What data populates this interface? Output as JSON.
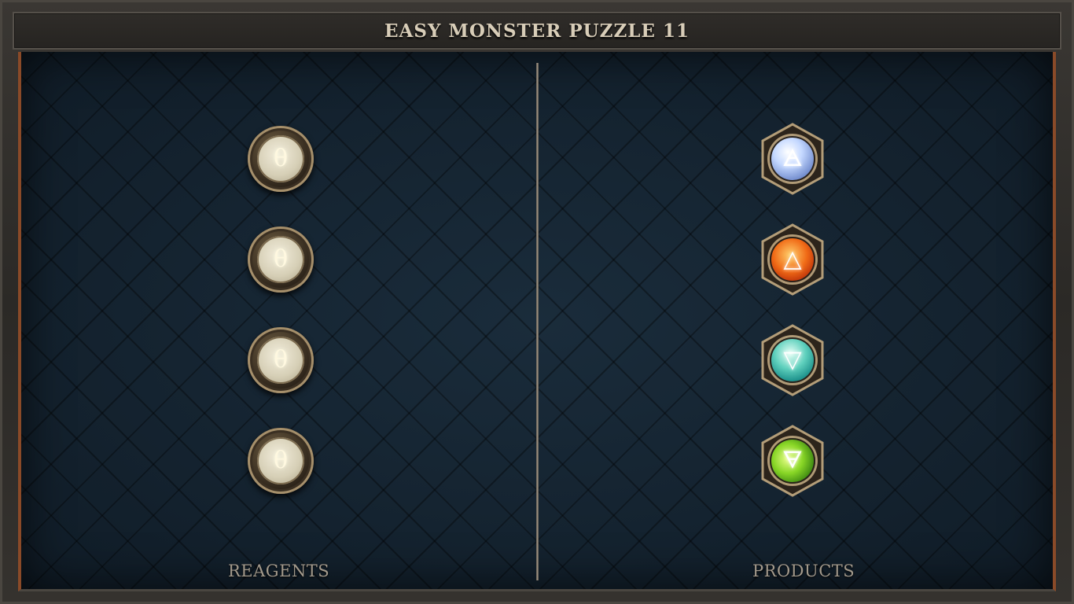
{
  "title": "EASY MONSTER PUZZLE 11",
  "columns": {
    "reagents_label": "REAGENTS",
    "products_label": "PRODUCTS"
  },
  "reagents": [
    {
      "symbol": "θ",
      "icon": "theta-rune-icon"
    },
    {
      "symbol": "θ",
      "icon": "theta-rune-icon"
    },
    {
      "symbol": "θ",
      "icon": "theta-rune-icon"
    },
    {
      "symbol": "θ",
      "icon": "theta-rune-icon"
    }
  ],
  "products": [
    {
      "element": "air",
      "symbol": "🜁",
      "icon": "air-element-icon",
      "color": "#c4d8ff"
    },
    {
      "element": "fire",
      "symbol": "△",
      "icon": "fire-element-icon",
      "color": "#f06a16"
    },
    {
      "element": "water",
      "symbol": "▽",
      "icon": "water-element-icon",
      "color": "#5fd0bd"
    },
    {
      "element": "earth",
      "symbol": "🜃",
      "icon": "earth-element-icon",
      "color": "#88d626"
    }
  ],
  "colors": {
    "board": "#152431",
    "frame": "#2b2926",
    "accent_border": "#8a4a28",
    "title_text": "#d8cdb8"
  }
}
